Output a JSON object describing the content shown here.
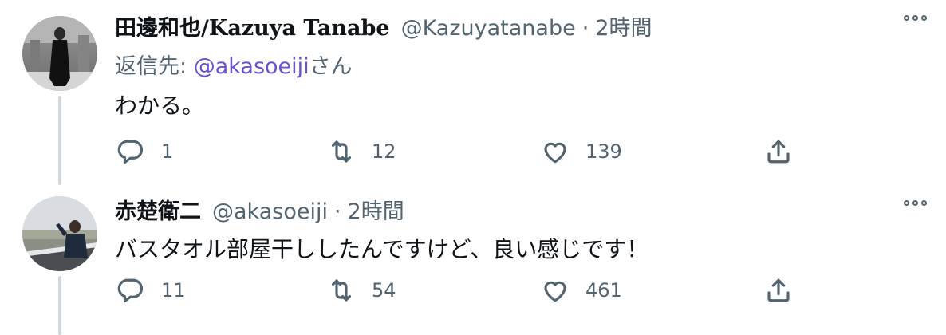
{
  "tweets": [
    {
      "name": "田邊和也/",
      "name_latin": "Kazuya Tanabe",
      "handle": "@Kazuyatanabe",
      "separator": "·",
      "time": "2時間",
      "reply_prefix": "返信先: ",
      "reply_mention": "@akasoeiji",
      "reply_suffix": "さん",
      "text": "わかる。",
      "replies": "1",
      "retweets": "12",
      "likes": "139"
    },
    {
      "name": "赤楚衛二",
      "handle": "@akasoeiji",
      "separator": "·",
      "time": "2時間",
      "text": "バスタオル部屋干ししたんですけど、良い感じです！",
      "replies": "11",
      "retweets": "54",
      "likes": "461"
    }
  ],
  "icons": {
    "reply": "reply-icon",
    "retweet": "retweet-icon",
    "like": "heart-icon",
    "share": "share-icon",
    "more": "more-icon"
  },
  "colors": {
    "mention": "#6f4fd1",
    "secondary_text": "#536471",
    "thread_line": "#cfd9de"
  }
}
